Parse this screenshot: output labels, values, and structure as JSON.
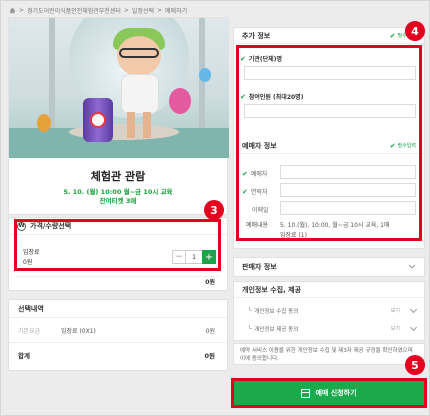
{
  "breadcrumb": {
    "items": [
      "경기도어린이식품안전체험관부천센터",
      "일정선택",
      "예매하기"
    ],
    "sep": ">"
  },
  "event": {
    "title": "체험관 관람",
    "schedule": "5. 10. (월) 10:00 월~금 10시 교육",
    "remaining": "잔여티켓 3매"
  },
  "price": {
    "heading": "가격/수량선택",
    "won_symbol": "W",
    "ticket_label": "입장료",
    "ticket_price": "0원",
    "quantity": "1",
    "minus": "−",
    "plus": "+",
    "total": "0원"
  },
  "selection": {
    "heading": "선택내역",
    "category": "기본요금",
    "item": "입장료 (0X1)",
    "item_price": "0원",
    "sum_label": "합계",
    "sum_value": "0원"
  },
  "additional": {
    "heading": "추가 정보",
    "required": "필수입력",
    "field1_label": "기관(단체)명",
    "field2_label": "참여인원 (최대20명)"
  },
  "booker": {
    "heading": "예매자 정보",
    "required": "필수입력",
    "name_label": "예매자",
    "phone_label": "연락처",
    "email_label": "이메일",
    "content_label": "예매내용",
    "content_line1": "5. 10.(월), 10:00, 월~금 10시 교육, 1매",
    "content_line2": "입장료 (1)"
  },
  "seller": {
    "heading": "판매자 정보"
  },
  "privacy": {
    "heading": "개인정보 수집, 제공",
    "item1": "개인정보 수집 동의",
    "item2": "개인정보 제공 동의",
    "view": "보기"
  },
  "notice": {
    "text": "예약 서비스 이용을 위한 개인정보 수집 및 제3자 제공 규정을 확인하였으며 이에 동의합니다."
  },
  "book_button": {
    "label": "예매 신청하기"
  },
  "annotations": {
    "n3": "3",
    "n4": "4",
    "n5": "5"
  },
  "colors": {
    "accent_green": "#1aaa4b",
    "highlight_red": "#e5001f"
  }
}
